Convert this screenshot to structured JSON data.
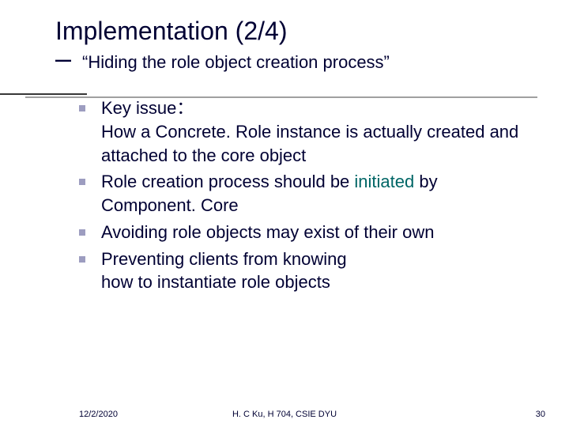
{
  "header": {
    "title": "Implementation (2/4)",
    "dash": "–",
    "subtitle": "“Hiding the role object creation process”"
  },
  "bullets": {
    "b1_a": "Key issue：",
    "b1_b": "How a Concrete. Role instance is actually created and attached to the core object",
    "b2_a": "Role creation process should be ",
    "b2_b": "initiated",
    "b2_c": " by Component. Core",
    "b3": "Avoiding role objects may exist of their own",
    "b4_a": "Preventing clients from knowing",
    "b4_b": "how to instantiate role objects"
  },
  "footer": {
    "date": "12/2/2020",
    "author": "H. C Ku, H 704, CSIE DYU",
    "page": "30"
  }
}
